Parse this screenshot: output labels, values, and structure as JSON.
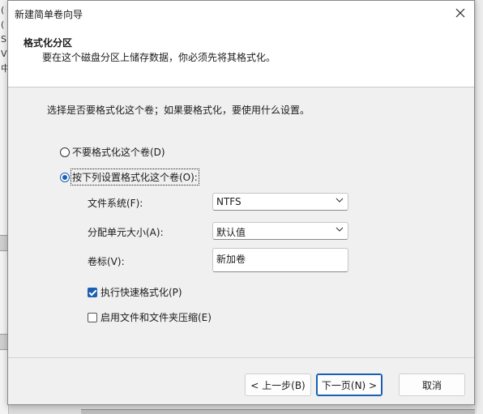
{
  "background": {
    "left_fragments": [
      "(",
      "(",
      "S",
      "V",
      "中"
    ]
  },
  "dialog": {
    "title": "新建简单卷向导",
    "close_icon": "close-icon",
    "header_title": "格式化分区",
    "header_subtitle": "要在这个磁盘分区上储存数据，你必须先将其格式化。",
    "prompt": "选择是否要格式化这个卷；如果要格式化，要使用什么设置。",
    "radio_no_format": "不要格式化这个卷(D)",
    "radio_format": "按下列设置格式化这个卷(O):",
    "selected_option": "format",
    "fields": {
      "filesystem_label": "文件系统(F):",
      "filesystem_value": "NTFS",
      "allocation_label": "分配单元大小(A):",
      "allocation_value": "默认值",
      "volume_label": "卷标(V):",
      "volume_value": "新加卷"
    },
    "checks": {
      "quick_format_label": "执行快速格式化(P)",
      "quick_format_checked": true,
      "compression_label": "启用文件和文件夹压缩(E)",
      "compression_checked": false
    },
    "buttons": {
      "back": "< 上一步(B)",
      "next": "下一页(N) >",
      "cancel": "取消"
    },
    "colors": {
      "accent": "#1a5fb4"
    }
  }
}
